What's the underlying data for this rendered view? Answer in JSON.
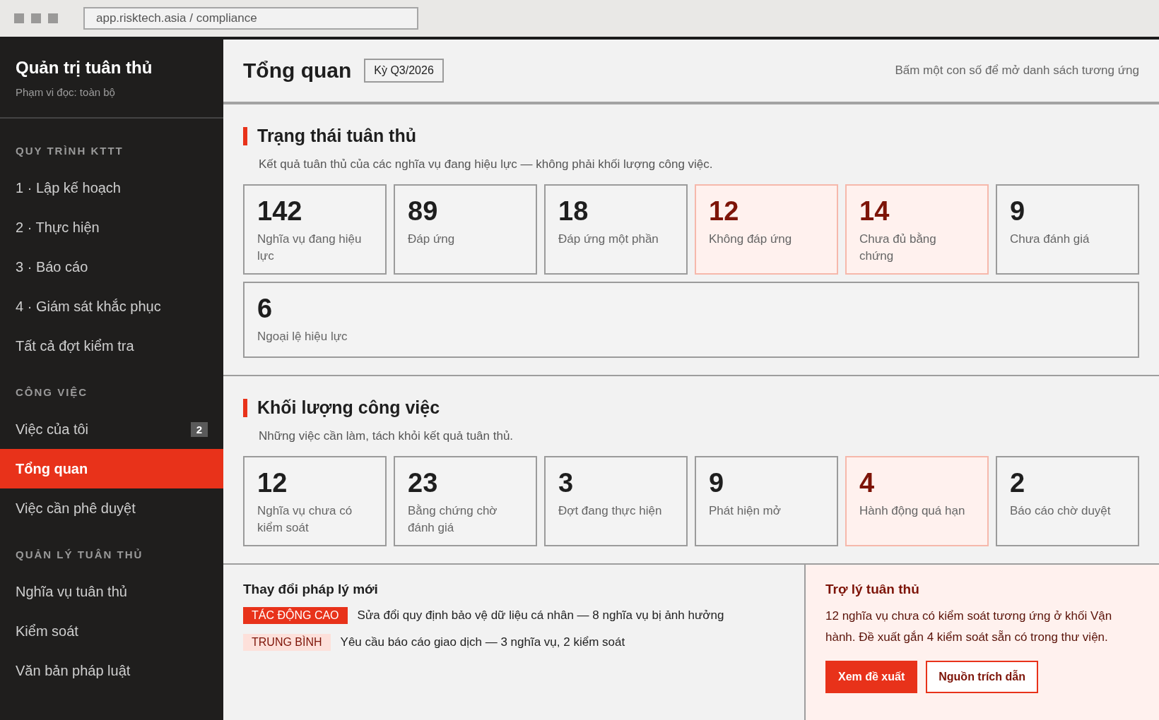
{
  "browser": {
    "address": "app.risktech.asia / compliance"
  },
  "sidebar": {
    "title": "Quản trị tuân thủ",
    "subtitle": "Phạm vi đọc: toàn bộ",
    "groups": [
      {
        "label": "QUY TRÌNH KTTT",
        "items": [
          {
            "text": "1 · Lập kế hoạch",
            "selected": false
          },
          {
            "text": "2 · Thực hiện",
            "selected": false
          },
          {
            "text": "3 · Báo cáo",
            "selected": false
          },
          {
            "text": "4 · Giám sát khắc phục",
            "selected": false
          },
          {
            "text": "Tất cả đợt kiểm tra",
            "selected": false
          }
        ]
      },
      {
        "label": "CÔNG VIỆC",
        "items": [
          {
            "text": "Việc của tôi",
            "selected": false,
            "badge": "2"
          },
          {
            "text": "Tổng quan",
            "selected": true
          },
          {
            "text": "Việc cần phê duyệt",
            "selected": false
          }
        ]
      },
      {
        "label": "QUẢN LÝ TUÂN THỦ",
        "items": [
          {
            "text": "Nghĩa vụ tuân thủ",
            "selected": false
          },
          {
            "text": "Kiểm soát",
            "selected": false
          },
          {
            "text": "Văn bản pháp luật",
            "selected": false
          }
        ]
      }
    ]
  },
  "header": {
    "title": "Tổng quan",
    "period": "Kỳ Q3/2026",
    "hint": "Bấm một con số để mở danh sách tương ứng"
  },
  "sections": [
    {
      "title": "Trạng thái tuân thủ",
      "description": "Kết quả tuân thủ của các nghĩa vụ đang hiệu lực — không phải khối lượng công việc.",
      "cards": [
        {
          "value": "142",
          "label": "Nghĩa vụ đang hiệu lực",
          "kind": "normal"
        },
        {
          "value": "89",
          "label": "Đáp ứng",
          "kind": "normal"
        },
        {
          "value": "18",
          "label": "Đáp ứng một phần",
          "kind": "normal"
        },
        {
          "value": "12",
          "label": "Không đáp ứng",
          "kind": "alert"
        },
        {
          "value": "14",
          "label": "Chưa đủ bằng chứng",
          "kind": "alert"
        },
        {
          "value": "9",
          "label": "Chưa đánh giá",
          "kind": "normal"
        },
        {
          "value": "6",
          "label": "Ngoại lệ hiệu lực",
          "kind": "normal"
        }
      ]
    },
    {
      "title": "Khối lượng công việc",
      "description": "Những việc cần làm, tách khỏi kết quả tuân thủ.",
      "cards": [
        {
          "value": "12",
          "label": "Nghĩa vụ chưa có kiểm soát",
          "kind": "normal"
        },
        {
          "value": "23",
          "label": "Bằng chứng chờ đánh giá",
          "kind": "normal"
        },
        {
          "value": "3",
          "label": "Đợt đang thực hiện",
          "kind": "normal"
        },
        {
          "value": "9",
          "label": "Phát hiện mở",
          "kind": "normal"
        },
        {
          "value": "4",
          "label": "Hành động quá hạn",
          "kind": "alert"
        },
        {
          "value": "2",
          "label": "Báo cáo chờ duyệt",
          "kind": "normal"
        }
      ]
    }
  ],
  "legal_changes": {
    "title": "Thay đổi pháp lý mới",
    "items": [
      {
        "tag": "TÁC ĐỘNG CAO",
        "kind": "high",
        "text": "Sửa đổi quy định bảo vệ dữ liệu cá nhân — 8 nghĩa vụ bị ảnh hưởng"
      },
      {
        "tag": "TRUNG BÌNH",
        "kind": "medium",
        "text": "Yêu cầu báo cáo giao dịch — 3 nghĩa vụ, 2 kiểm soát"
      }
    ]
  },
  "assistant": {
    "title": "Trợ lý tuân thủ",
    "text": "12 nghĩa vụ chưa có kiểm soát tương ứng ở khối Vận hành. Đề xuất gắn 4 kiểm soát sẵn có trong thư viện.",
    "buttons": [
      {
        "label": "Xem đề xuất",
        "kind": "primary"
      },
      {
        "label": "Nguồn trích dẫn",
        "kind": "secondary"
      }
    ]
  }
}
